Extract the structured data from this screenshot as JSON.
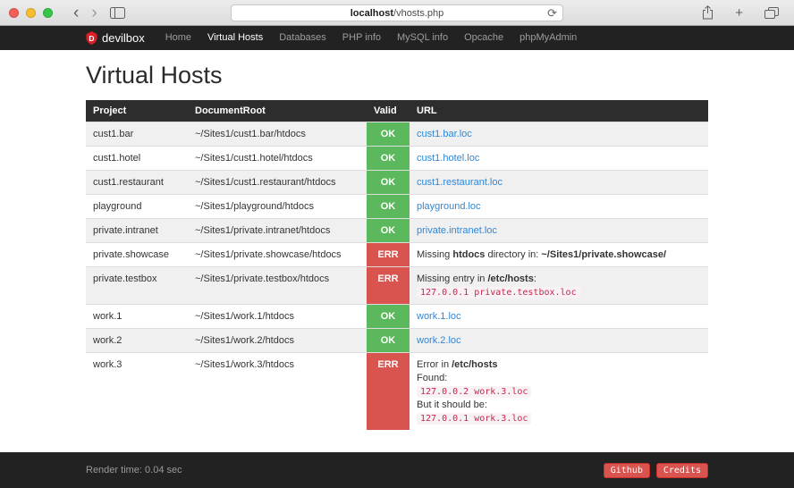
{
  "browser": {
    "url_domain": "localhost",
    "url_path": "/vhosts.php"
  },
  "icons": {
    "back": "‹",
    "forward": "›",
    "reload": "⟳",
    "new_tab": "+"
  },
  "colors": {
    "ok": "#5cb85c",
    "err": "#d9534f",
    "link": "#2f87d8",
    "dark-bar": "#222222",
    "table-head": "#2d2d2d"
  },
  "navbar": {
    "brand": "devilbox",
    "items": [
      {
        "label": "Home",
        "active": false
      },
      {
        "label": "Virtual Hosts",
        "active": true
      },
      {
        "label": "Databases",
        "active": false
      },
      {
        "label": "PHP info",
        "active": false
      },
      {
        "label": "MySQL info",
        "active": false
      },
      {
        "label": "Opcache",
        "active": false
      },
      {
        "label": "phpMyAdmin",
        "active": false
      }
    ]
  },
  "page": {
    "title": "Virtual Hosts"
  },
  "table": {
    "headers": [
      "Project",
      "DocumentRoot",
      "Valid",
      "URL"
    ],
    "rows": [
      {
        "project": "cust1.bar",
        "docroot": "~/Sites1/cust1.bar/htdocs",
        "valid": "OK",
        "status": "ok",
        "url_lines": [
          [
            {
              "style": "link",
              "text": "cust1.bar.loc"
            }
          ]
        ]
      },
      {
        "project": "cust1.hotel",
        "docroot": "~/Sites1/cust1.hotel/htdocs",
        "valid": "OK",
        "status": "ok",
        "url_lines": [
          [
            {
              "style": "link",
              "text": "cust1.hotel.loc"
            }
          ]
        ]
      },
      {
        "project": "cust1.restaurant",
        "docroot": "~/Sites1/cust1.restaurant/htdocs",
        "valid": "OK",
        "status": "ok",
        "url_lines": [
          [
            {
              "style": "link",
              "text": "cust1.restaurant.loc"
            }
          ]
        ]
      },
      {
        "project": "playground",
        "docroot": "~/Sites1/playground/htdocs",
        "valid": "OK",
        "status": "ok",
        "url_lines": [
          [
            {
              "style": "link",
              "text": "playground.loc"
            }
          ]
        ]
      },
      {
        "project": "private.intranet",
        "docroot": "~/Sites1/private.intranet/htdocs",
        "valid": "OK",
        "status": "ok",
        "url_lines": [
          [
            {
              "style": "link",
              "text": "private.intranet.loc"
            }
          ]
        ]
      },
      {
        "project": "private.showcase",
        "docroot": "~/Sites1/private.showcase/htdocs",
        "valid": "ERR",
        "status": "err",
        "url_lines": [
          [
            {
              "style": "normal",
              "text": "Missing "
            },
            {
              "style": "bold",
              "text": "htdocs"
            },
            {
              "style": "normal",
              "text": " directory in: "
            },
            {
              "style": "bold",
              "text": "~/Sites1/private.showcase/"
            }
          ]
        ]
      },
      {
        "project": "private.testbox",
        "docroot": "~/Sites1/private.testbox/htdocs",
        "valid": "ERR",
        "status": "err",
        "url_lines": [
          [
            {
              "style": "normal",
              "text": "Missing entry in "
            },
            {
              "style": "bold",
              "text": "/etc/hosts"
            },
            {
              "style": "normal",
              "text": ":"
            }
          ],
          [
            {
              "style": "code",
              "text": "127.0.0.1 private.testbox.loc"
            }
          ]
        ]
      },
      {
        "project": "work.1",
        "docroot": "~/Sites1/work.1/htdocs",
        "valid": "OK",
        "status": "ok",
        "url_lines": [
          [
            {
              "style": "link",
              "text": "work.1.loc"
            }
          ]
        ]
      },
      {
        "project": "work.2",
        "docroot": "~/Sites1/work.2/htdocs",
        "valid": "OK",
        "status": "ok",
        "url_lines": [
          [
            {
              "style": "link",
              "text": "work.2.loc"
            }
          ]
        ]
      },
      {
        "project": "work.3",
        "docroot": "~/Sites1/work.3/htdocs",
        "valid": "ERR",
        "status": "err",
        "url_lines": [
          [
            {
              "style": "normal",
              "text": "Error in "
            },
            {
              "style": "bold",
              "text": "/etc/hosts"
            }
          ],
          [
            {
              "style": "normal",
              "text": "Found:"
            }
          ],
          [
            {
              "style": "code",
              "text": "127.0.0.2 work.3.loc"
            }
          ],
          [
            {
              "style": "normal",
              "text": "But it should be:"
            }
          ],
          [
            {
              "style": "code",
              "text": "127.0.0.1 work.3.loc"
            }
          ]
        ]
      }
    ]
  },
  "footer": {
    "render_time": "Render time: 0.04 sec",
    "github_label": "Github",
    "credits_label": "Credits"
  }
}
